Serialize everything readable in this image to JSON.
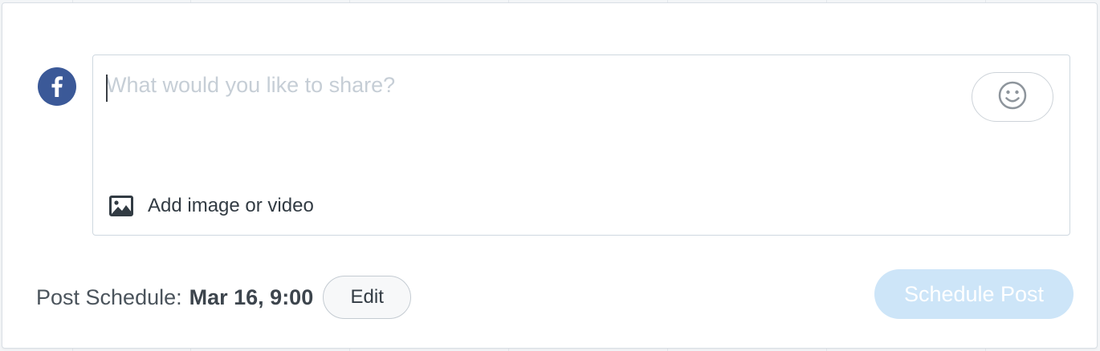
{
  "composer": {
    "network": "facebook",
    "network_icon": "facebook-icon",
    "post_text": "",
    "placeholder": "What would you like to share?",
    "emoji_icon": "smiley-icon",
    "media_icon": "image-icon",
    "media_label": "Add image or video"
  },
  "schedule": {
    "label": "Post Schedule:",
    "date": "Mar 16, 9:00",
    "edit_label": "Edit",
    "submit_label": "Schedule Post"
  },
  "colors": {
    "facebook": "#3b5998",
    "submit_disabled": "#cde5f8",
    "placeholder": "#c6ced6"
  }
}
